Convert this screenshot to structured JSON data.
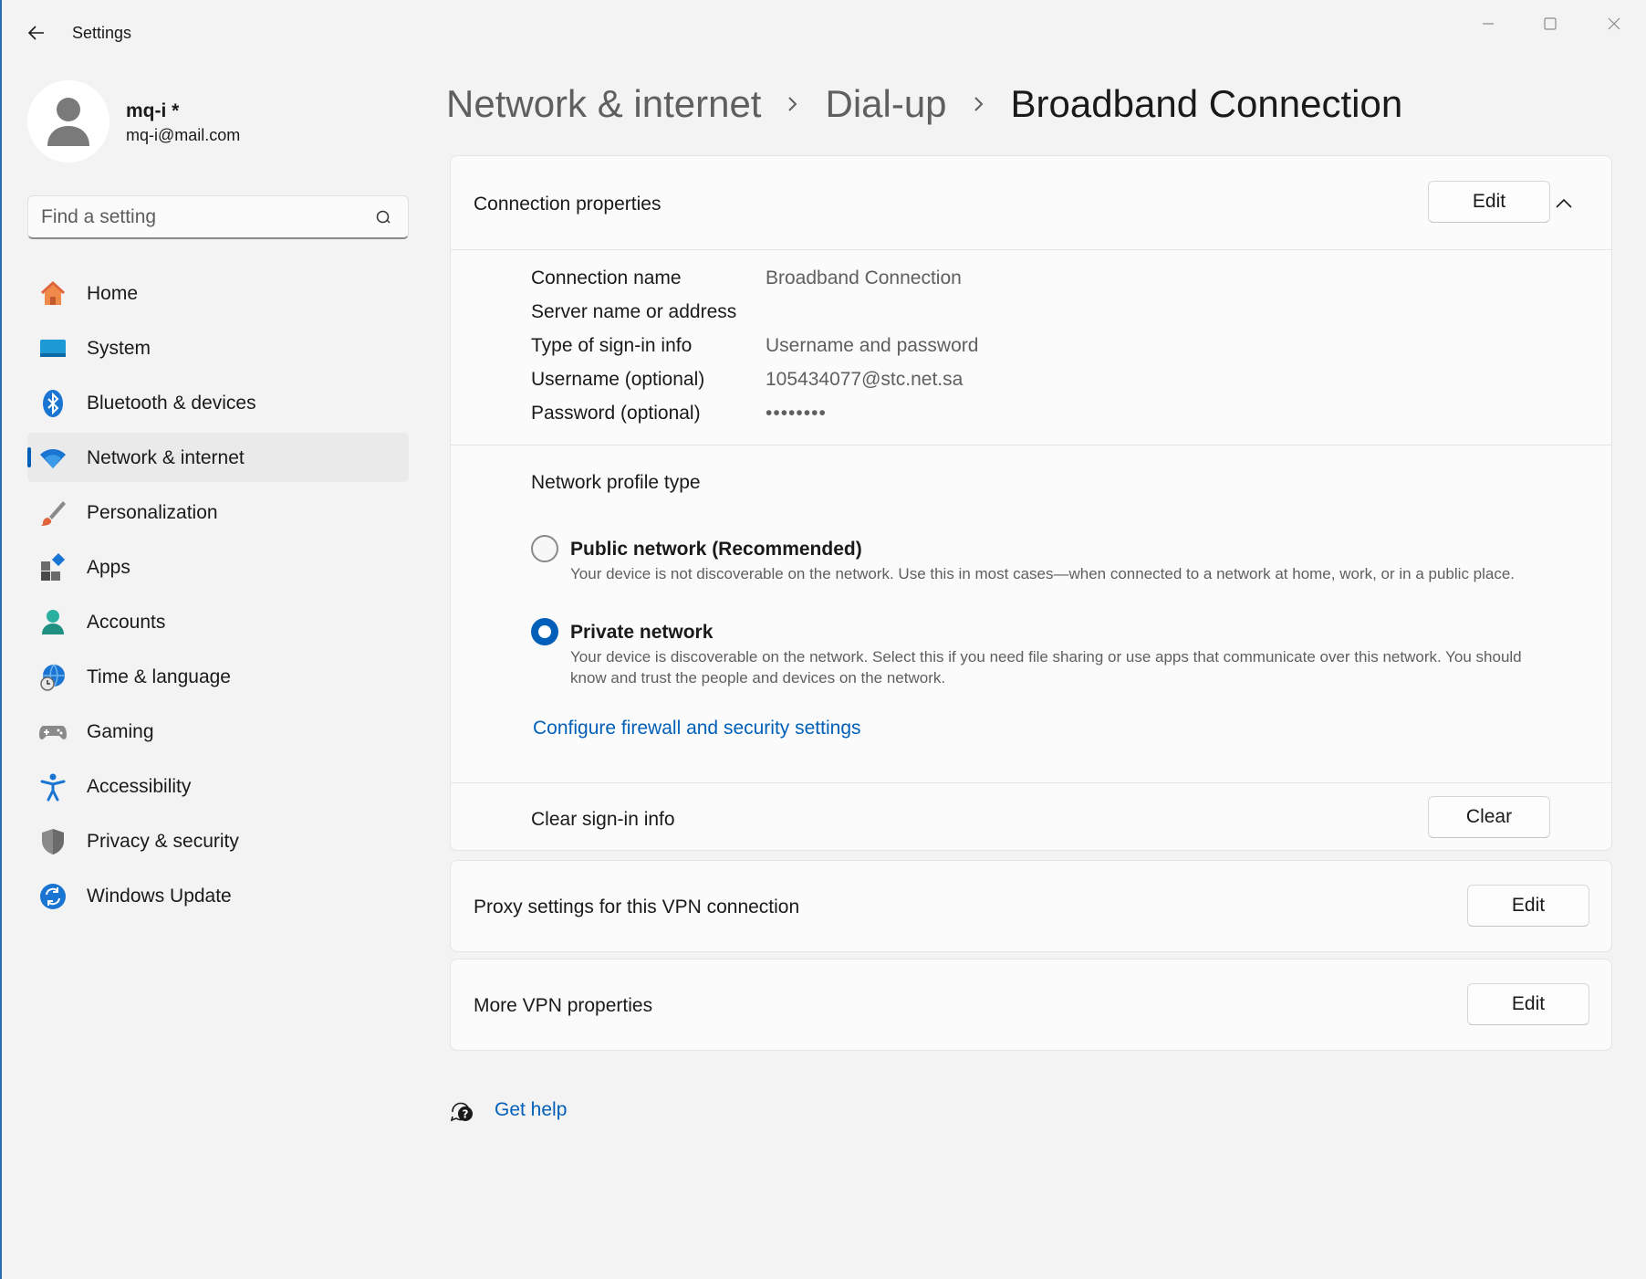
{
  "window": {
    "title": "Settings",
    "accent_color": "#005fb8"
  },
  "profile": {
    "name": "mq-i *",
    "email": "mq-i@mail.com"
  },
  "search": {
    "placeholder": "Find a setting"
  },
  "nav": {
    "items": [
      {
        "label": "Home",
        "icon": "home-icon"
      },
      {
        "label": "System",
        "icon": "system-icon"
      },
      {
        "label": "Bluetooth & devices",
        "icon": "bluetooth-icon"
      },
      {
        "label": "Network & internet",
        "icon": "wifi-icon",
        "selected": true
      },
      {
        "label": "Personalization",
        "icon": "brush-icon"
      },
      {
        "label": "Apps",
        "icon": "apps-icon"
      },
      {
        "label": "Accounts",
        "icon": "accounts-icon"
      },
      {
        "label": "Time & language",
        "icon": "globe-clock-icon"
      },
      {
        "label": "Gaming",
        "icon": "gamepad-icon"
      },
      {
        "label": "Accessibility",
        "icon": "accessibility-icon"
      },
      {
        "label": "Privacy & security",
        "icon": "shield-icon"
      },
      {
        "label": "Windows Update",
        "icon": "update-icon"
      }
    ]
  },
  "breadcrumb": {
    "items": [
      "Network & internet",
      "Dial-up",
      "Broadband Connection"
    ]
  },
  "connection_properties": {
    "title": "Connection properties",
    "edit_label": "Edit",
    "properties": [
      {
        "label": "Connection name",
        "value": "Broadband Connection"
      },
      {
        "label": "Server name or address",
        "value": ""
      },
      {
        "label": "Type of sign-in info",
        "value": "Username and password"
      },
      {
        "label": "Username (optional)",
        "value": "105434077@stc.net.sa"
      },
      {
        "label": "Password (optional)",
        "value": "••••••••"
      }
    ],
    "network_profile": {
      "title": "Network profile type",
      "options": [
        {
          "title": "Public network (Recommended)",
          "description": "Your device is not discoverable on the network. Use this in most cases—when connected to a network at home, work, or in a public place.",
          "selected": false
        },
        {
          "title": "Private network",
          "description": "Your device is discoverable on the network. Select this if you need file sharing or use apps that communicate over this network. You should know and trust the people and devices on the network.",
          "selected": true
        }
      ],
      "firewall_link": "Configure firewall and security settings"
    },
    "clear_signin": {
      "label": "Clear sign-in info",
      "button": "Clear"
    }
  },
  "proxy": {
    "label": "Proxy settings for this VPN connection",
    "button": "Edit"
  },
  "more_vpn": {
    "label": "More VPN properties",
    "button": "Edit"
  },
  "help": {
    "label": "Get help"
  }
}
